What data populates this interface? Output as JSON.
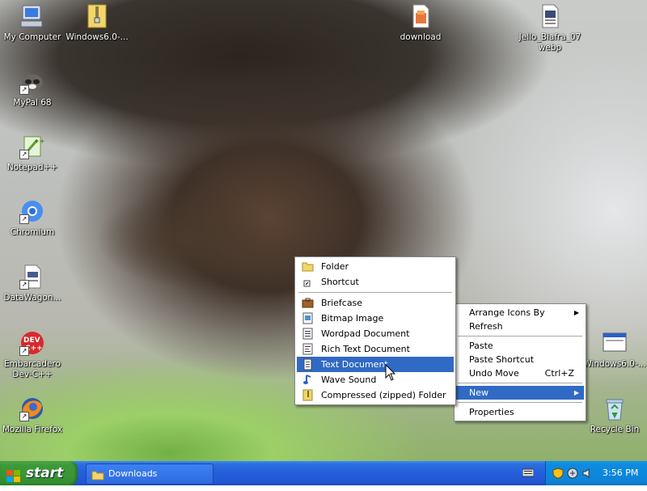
{
  "desktop": {
    "icons": [
      {
        "label": "My Computer"
      },
      {
        "label": "Windows6.0-..."
      },
      {
        "label": "download"
      },
      {
        "label": "Jello_Biafra_07"
      },
      {
        "label": "webp"
      },
      {
        "label": "MyPal 68"
      },
      {
        "label": "Notepad++"
      },
      {
        "label": "Chromium"
      },
      {
        "label": "DataWagon..."
      },
      {
        "label": "Embarcadero"
      },
      {
        "label": "Dev-C++"
      },
      {
        "label": "Mozilla Firefox"
      },
      {
        "label": "Windows6.0-..."
      },
      {
        "label": "Recycle Bin"
      }
    ]
  },
  "context_menu": {
    "items": [
      {
        "label": "Arrange Icons By"
      },
      {
        "label": "Refresh"
      },
      {
        "label": "Paste"
      },
      {
        "label": "Paste Shortcut"
      },
      {
        "label": "Undo Move",
        "accel": "Ctrl+Z"
      },
      {
        "label": "New"
      },
      {
        "label": "Properties"
      }
    ]
  },
  "new_submenu": {
    "items": [
      {
        "label": "Folder"
      },
      {
        "label": "Shortcut"
      },
      {
        "label": "Briefcase"
      },
      {
        "label": "Bitmap Image"
      },
      {
        "label": "Wordpad Document"
      },
      {
        "label": "Rich Text Document"
      },
      {
        "label": "Text Document"
      },
      {
        "label": "Wave Sound"
      },
      {
        "label": "Compressed (zipped) Folder"
      }
    ]
  },
  "taskbar": {
    "start_label": "start",
    "tasks": [
      {
        "label": "Downloads"
      }
    ],
    "clock": "3:56 PM"
  },
  "colors": {
    "taskbar_blue": "#245edb",
    "start_green": "#3a9534",
    "highlight": "#316ac5",
    "tray_blue": "#0c83d8"
  }
}
